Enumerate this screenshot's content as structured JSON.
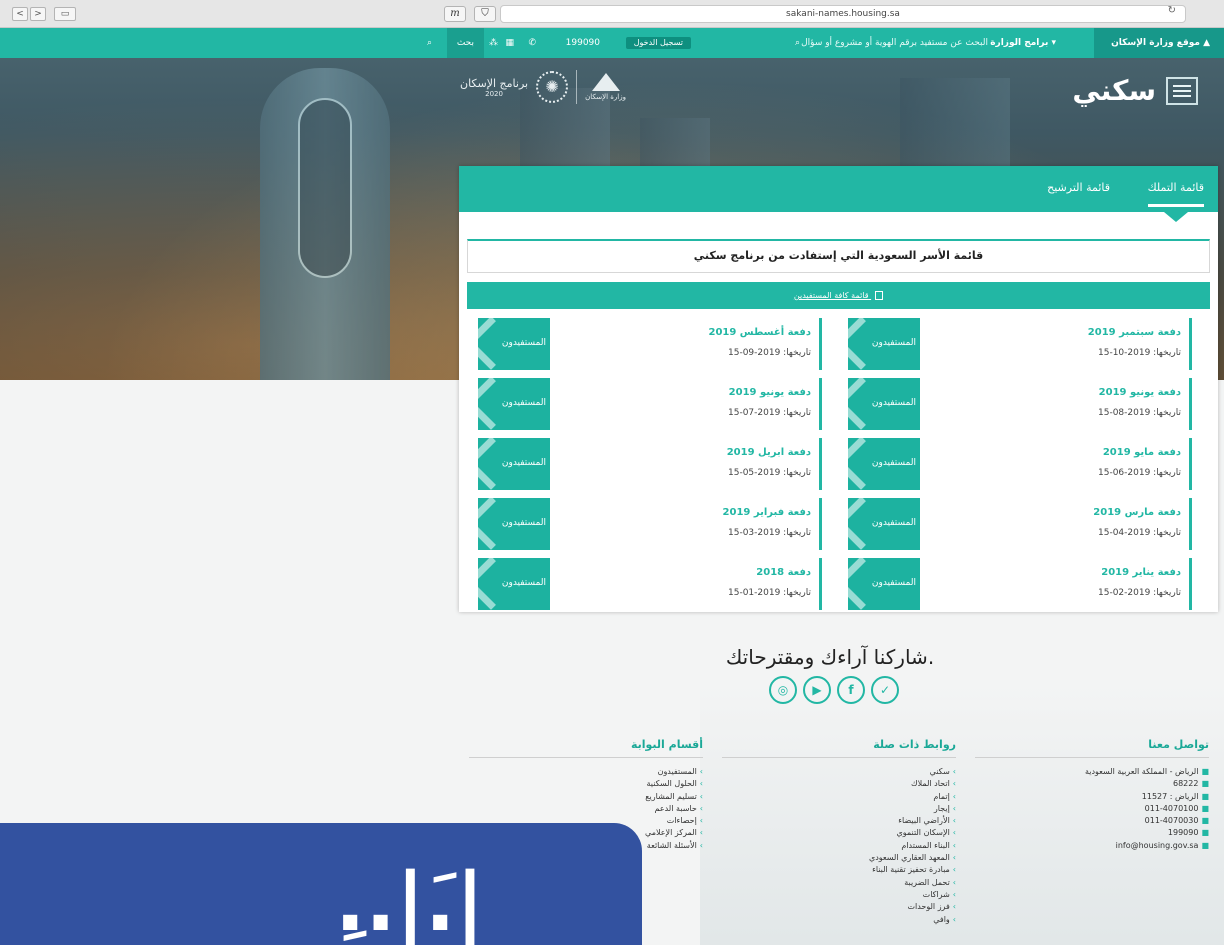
{
  "browser": {
    "url": "sakani-names.housing.sa",
    "nav": [
      "<",
      ">"
    ],
    "ext_label": "m",
    "reload": "↻"
  },
  "topbar": {
    "ministry": "موقع وزارة الإسكان",
    "programs": "برامج الوزارة ▾",
    "search_placeholder": "البحث عن مستفيد برقم الهوية أو مشروع أو سؤال",
    "login": "تسجيل الدخول",
    "phone": "199090",
    "search": "بحث",
    "icons": [
      "home-icon",
      "search-icon",
      "phone-icon",
      "calendar-icon",
      "sitemap-icon"
    ]
  },
  "logos": {
    "sakani": "سكني",
    "program": "برنامج الإسكان",
    "program_year": "2020",
    "ministry": "وزارة الإسكان"
  },
  "card": {
    "tabs": [
      "قائمة التملك",
      "قائمة الترشيح"
    ],
    "title": "قائمة الأسر السعودية التي إستفادت من برنامج سكني",
    "all_link": "قائمة كافة المستفيدين",
    "beneficiaries_button": "المستفيدون",
    "batches_right": [
      {
        "label": "دفعة سبتمبر 2019",
        "date": "تاريخها: 2019-10-15"
      },
      {
        "label": "دفعة يونيو 2019",
        "date": "تاريخها: 2019-08-15"
      },
      {
        "label": "دفعة مايو 2019",
        "date": "تاريخها: 2019-06-15"
      },
      {
        "label": "دفعة مارس 2019",
        "date": "تاريخها: 2019-04-15"
      },
      {
        "label": "دفعة يناير 2019",
        "date": "تاريخها: 2019-02-15"
      }
    ],
    "batches_left": [
      {
        "label": "دفعة أغسطس 2019",
        "date": "تاريخها: 2019-09-15"
      },
      {
        "label": "دفعة يونيو 2019",
        "date": "تاريخها: 2019-07-15"
      },
      {
        "label": "دفعة ابريل 2019",
        "date": "تاريخها: 2019-05-15"
      },
      {
        "label": "دفعة فبراير 2019",
        "date": "تاريخها: 2019-03-15"
      },
      {
        "label": "دفعة 2018",
        "date": "تاريخها: 2019-01-15"
      }
    ]
  },
  "share": {
    "title": "شاركنا آراءك ومقترحاتك.",
    "socials": [
      "instagram-icon",
      "youtube-icon",
      "facebook-icon",
      "twitter-icon"
    ],
    "glyphs": [
      "◎",
      "▶",
      "f",
      "✓"
    ]
  },
  "footer": {
    "contact": {
      "title": "تواصل معنا",
      "items": [
        "الرياض - المملكة العربية السعودية",
        "68222",
        "الرياض : 11527",
        "011-4070100",
        "011-4070030",
        "199090",
        "info@housing.gov.sa"
      ]
    },
    "links": {
      "title": "روابط ذات صلة",
      "items": [
        "سكني",
        "اتحاد الملاك",
        "إتمام",
        "إيجار",
        "الأراضي البيضاء",
        "الإسكان التنموي",
        "البناء المستدام",
        "المعهد العقاري السعودي",
        "مبادرة تحفيز تقنية البناء",
        "تحمل الضريبة",
        "شراكات",
        "فرز الوحدات",
        "وافي"
      ]
    },
    "portal": {
      "title": "أقسام البوابة",
      "items": [
        "المستفيدون",
        "الحلول السكنية",
        "تسليم المشاريع",
        "حاسبة الدعم",
        "إحصاءات",
        "المركز الإعلامي",
        "الأسئلة الشائعة"
      ]
    }
  },
  "overlay": {
    "text": "ِ..|.َ|"
  }
}
